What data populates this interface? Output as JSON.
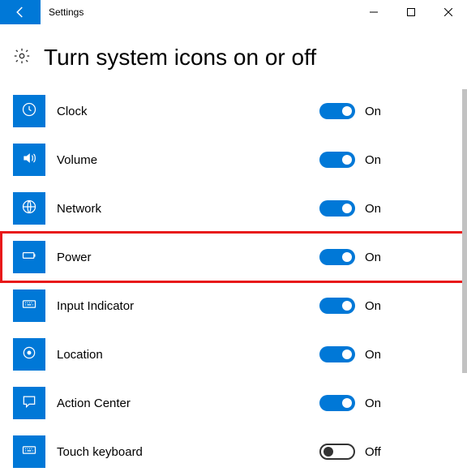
{
  "window": {
    "title": "Settings"
  },
  "page": {
    "heading": "Turn system icons on or off"
  },
  "labels": {
    "on": "On",
    "off": "Off"
  },
  "items": [
    {
      "key": "clock",
      "label": "Clock",
      "icon": "clock-icon",
      "state": true,
      "highlight": false
    },
    {
      "key": "volume",
      "label": "Volume",
      "icon": "volume-icon",
      "state": true,
      "highlight": false
    },
    {
      "key": "network",
      "label": "Network",
      "icon": "globe-icon",
      "state": true,
      "highlight": false
    },
    {
      "key": "power",
      "label": "Power",
      "icon": "battery-icon",
      "state": true,
      "highlight": true
    },
    {
      "key": "input-indicator",
      "label": "Input Indicator",
      "icon": "keyboard-icon",
      "state": true,
      "highlight": false
    },
    {
      "key": "location",
      "label": "Location",
      "icon": "target-icon",
      "state": true,
      "highlight": false
    },
    {
      "key": "action-center",
      "label": "Action Center",
      "icon": "message-icon",
      "state": true,
      "highlight": false
    },
    {
      "key": "touch-keyboard",
      "label": "Touch keyboard",
      "icon": "keyboard-icon",
      "state": false,
      "highlight": false
    }
  ]
}
